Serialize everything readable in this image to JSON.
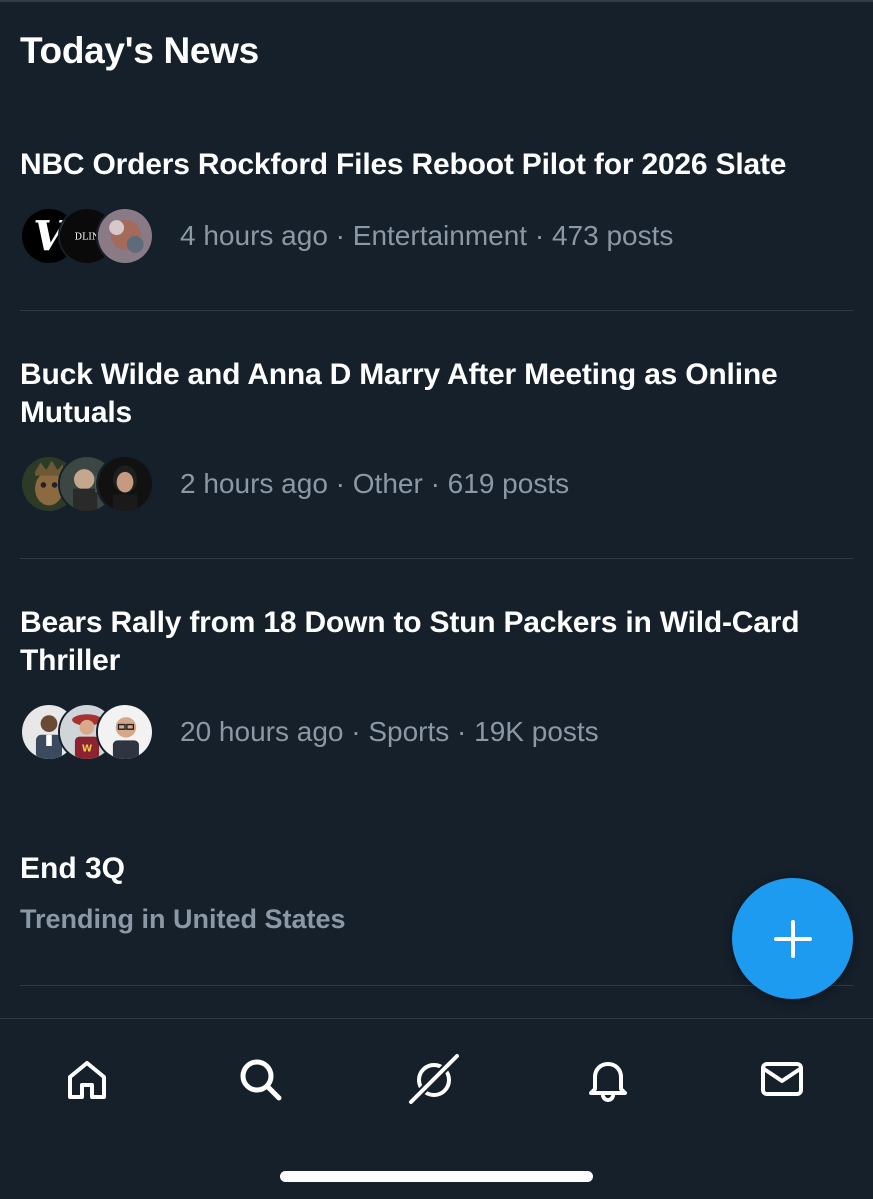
{
  "section_title": "Today's News",
  "news": [
    {
      "headline": "NBC Orders Rockford Files Reboot Pilot for 2026 Slate",
      "meta": "4 hours ago · Entertainment · 473 posts",
      "avatar_labels": [
        "V",
        "DLINE"
      ]
    },
    {
      "headline": "Buck Wilde and Anna D Marry After Meeting as Online Mutuals",
      "meta": "2 hours ago · Other · 619 posts"
    },
    {
      "headline": "Bears Rally from 18 Down to Stun Packers in Wild-Card Thriller",
      "meta": "20 hours ago · Sports · 19K posts"
    }
  ],
  "trend": {
    "title": "End 3Q",
    "subtitle": "Trending in United States"
  },
  "tabs": [
    "home-icon",
    "search-icon",
    "grok-icon",
    "bell-icon",
    "mail-icon"
  ],
  "colors": {
    "background": "#15202b",
    "accent": "#1d9bf0",
    "secondary_text": "#8b98a5"
  }
}
